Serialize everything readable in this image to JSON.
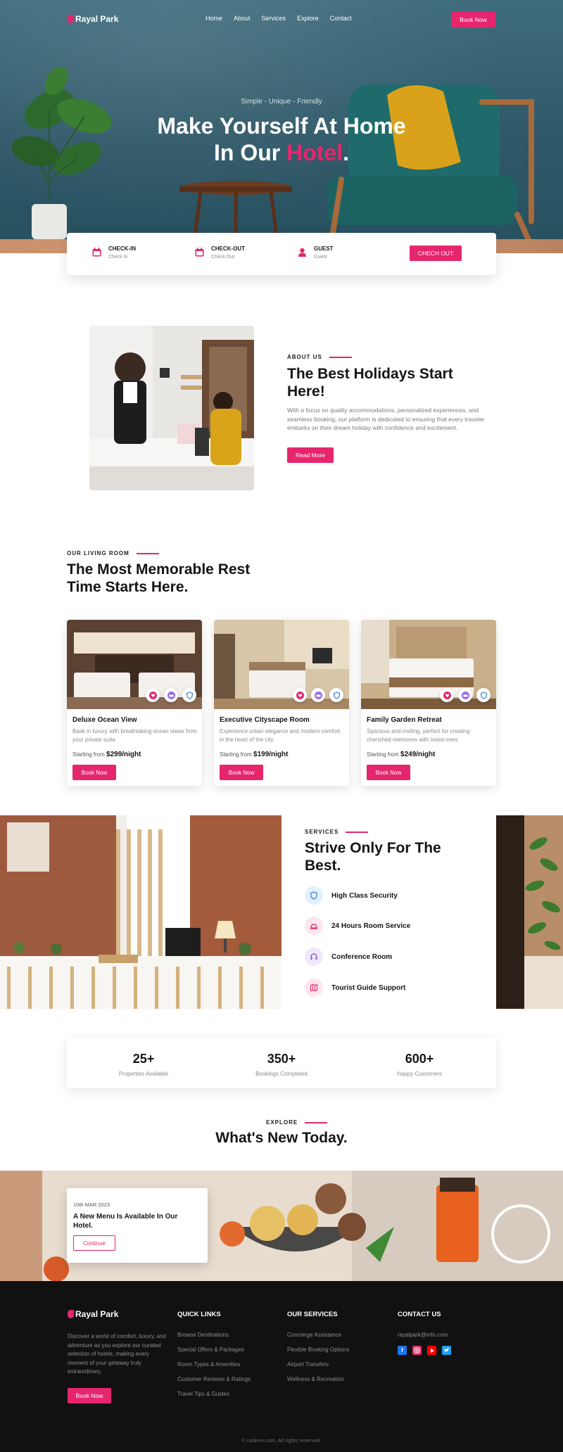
{
  "brand": {
    "name": "Rayal Park"
  },
  "nav": {
    "links": [
      "Home",
      "About",
      "Services",
      "Explore",
      "Contact"
    ],
    "book_now": "Book Now"
  },
  "hero": {
    "tagline": "Simple - Unique - Friendly",
    "title_line1": "Make Yourself At Home",
    "title_line2_prefix": "In Our ",
    "title_line2_highlight": "Hotel",
    "title_line2_suffix": "."
  },
  "booking": {
    "checkin_label": "CHECK-IN",
    "checkin_value": "Check In",
    "checkout_label": "CHECK-OUT",
    "checkout_value": "Check Out",
    "guest_label": "GUEST",
    "guest_value": "Guest",
    "button": "CHECH OUT"
  },
  "about": {
    "eyebrow": "ABOUT US",
    "title": "The Best Holidays Start Here!",
    "text": "With a focus on quality accommodations, personalized experiences, and seamless booking, our platform is dedicated to ensuring that every traveler embarks on their dream holiday with confidence and excitement.",
    "button": "Read More"
  },
  "rooms_section": {
    "eyebrow": "OUR LIVING ROOM",
    "title": "The Most Memorable Rest Time Starts Here.",
    "rooms": [
      {
        "name": "Deluxe Ocean View",
        "desc": "Bask in luxury with breathtaking ocean views from your private suite.",
        "price_prefix": "Starting from ",
        "price": "$299/night",
        "button": "Book Now"
      },
      {
        "name": "Executive Cityscape Room",
        "desc": "Experience urban elegance and modern comfort in the heart of the city.",
        "price_prefix": "Starting from ",
        "price": "$199/night",
        "button": "Book Now"
      },
      {
        "name": "Family Garden Retreat",
        "desc": "Spacious and inviting, perfect for creating cherished memories with loved ones.",
        "price_prefix": "Starting from ",
        "price": "$249/night",
        "button": "Book Now"
      }
    ]
  },
  "services": {
    "eyebrow": "SERVICES",
    "title": "Strive Only For The Best.",
    "items": [
      "High Class Security",
      "24 Hours Room Service",
      "Conference Room",
      "Tourist Guide Support"
    ],
    "colors": [
      "#e3f0fb",
      "#fde6ee",
      "#efe8fb",
      "#fde6ee"
    ]
  },
  "stats": [
    {
      "value": "25+",
      "label": "Properties Available"
    },
    {
      "value": "350+",
      "label": "Bookings Completed"
    },
    {
      "value": "600+",
      "label": "Happy Customers"
    }
  ],
  "explore": {
    "eyebrow": "EXPLORE",
    "title": "What's New Today.",
    "news_date": "10th MAR 2023",
    "news_title": "A New Menu Is Available In Our Hotel.",
    "news_button": "Continue"
  },
  "footer": {
    "about": "Discover a world of comfort, luxury, and adventure as you explore our curated selection of hotels, making every moment of your getaway truly extraordinary.",
    "button": "Book Now",
    "quick_links_title": "QUICK LINKS",
    "quick_links": [
      "Browse Destinations",
      "Special Offers & Packages",
      "Room Types & Amenities",
      "Customer Reviews & Ratings",
      "Travel Tips & Guides"
    ],
    "services_title": "OUR SERVICES",
    "services": [
      "Concierge Assistance",
      "Flexible Booking Options",
      "Airport Transfers",
      "Wellness & Recreation"
    ],
    "contact_title": "CONTACT US",
    "email": "rayalpark@info.com",
    "social": [
      "f",
      "ig",
      "yt",
      "tw"
    ],
    "copyright": "© nzdevx.com. All rights reserved."
  },
  "colors": {
    "accent": "#e5266d",
    "hero": "#2f5868",
    "footer": "#111111"
  }
}
